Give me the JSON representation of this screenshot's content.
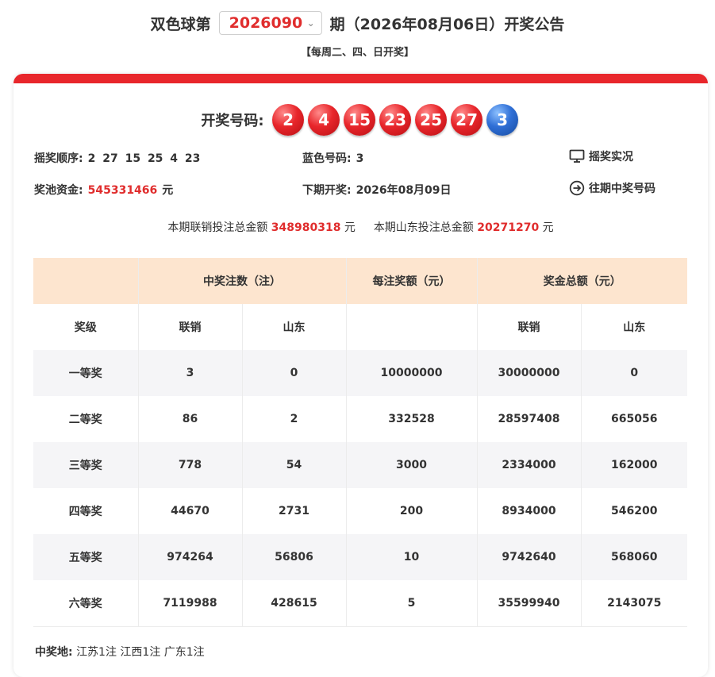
{
  "header": {
    "prefix": "双色球第",
    "issue": "2026090",
    "suffix": "期（2026年08月06日）开奖公告",
    "schedule": "【每周二、四、日开奖】"
  },
  "draw": {
    "label": "开奖号码:",
    "red_balls": [
      "2",
      "4",
      "15",
      "23",
      "25",
      "27"
    ],
    "blue_ball": "3",
    "red_color": "#e8262b",
    "blue_color": "#2f6fd6"
  },
  "info": {
    "order_label": "摇奖顺序:",
    "order_value": "2 27 15 25 4 23",
    "blue_label": "蓝色号码:",
    "blue_value": "3",
    "pool_label": "奖池资金:",
    "pool_value": "545331466",
    "pool_unit": "元",
    "next_label": "下期开奖:",
    "next_value": "2026年08月09日",
    "live_link": "摇奖实况",
    "history_link": "往期中奖号码"
  },
  "sales": {
    "union_label": "本期联销投注总金额",
    "union_value": "348980318",
    "union_unit": "元",
    "sd_label": "本期山东投注总金额",
    "sd_value": "20271270",
    "sd_unit": "元"
  },
  "table": {
    "header": {
      "blank": "",
      "count": "中奖注数（注）",
      "per": "每注奖额（元）",
      "total": "奖金总额（元）"
    },
    "sub": [
      "奖级",
      "联销",
      "山东",
      "",
      "联销",
      "山东"
    ],
    "rows": [
      {
        "level": "一等奖",
        "cnt_union": "3",
        "cnt_sd": "0",
        "per": "10000000",
        "tot_union": "30000000",
        "tot_sd": "0"
      },
      {
        "level": "二等奖",
        "cnt_union": "86",
        "cnt_sd": "2",
        "per": "332528",
        "tot_union": "28597408",
        "tot_sd": "665056"
      },
      {
        "level": "三等奖",
        "cnt_union": "778",
        "cnt_sd": "54",
        "per": "3000",
        "tot_union": "2334000",
        "tot_sd": "162000"
      },
      {
        "level": "四等奖",
        "cnt_union": "44670",
        "cnt_sd": "2731",
        "per": "200",
        "tot_union": "8934000",
        "tot_sd": "546200"
      },
      {
        "level": "五等奖",
        "cnt_union": "974264",
        "cnt_sd": "56806",
        "per": "10",
        "tot_union": "9742640",
        "tot_sd": "568060"
      },
      {
        "level": "六等奖",
        "cnt_union": "7119988",
        "cnt_sd": "428615",
        "per": "5",
        "tot_union": "35599940",
        "tot_sd": "2143075"
      }
    ]
  },
  "winners": {
    "label": "中奖地:",
    "value": "江苏1注 江西1注 广东1注"
  }
}
